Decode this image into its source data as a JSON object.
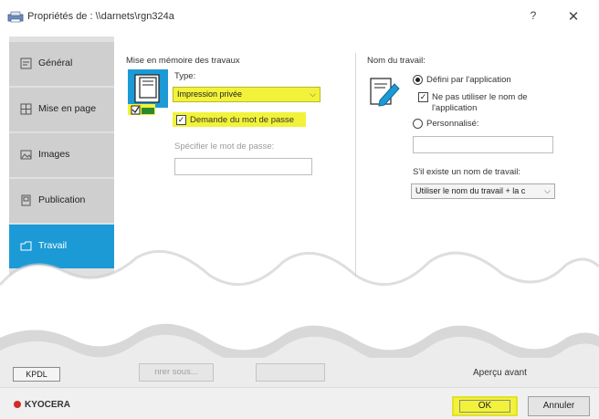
{
  "window": {
    "title": "Propriétés de : \\\\darnets\\rgn324a",
    "help_label": "?",
    "close_label": "✕"
  },
  "sidebar": {
    "items": [
      {
        "label": "Général",
        "icon": "document-icon"
      },
      {
        "label": "Mise en page",
        "icon": "layout-grid-icon"
      },
      {
        "label": "Images",
        "icon": "image-icon"
      },
      {
        "label": "Publication",
        "icon": "booklet-icon"
      },
      {
        "label": "Travail",
        "icon": "job-folder-icon",
        "active": true
      }
    ]
  },
  "job_storage": {
    "section_title": "Mise en mémoire des travaux",
    "type_label": "Type:",
    "type_value": "Impression privée",
    "password_request_label": "Demande du mot de passe",
    "password_request_checked": true,
    "specify_password_label": "Spécifier le mot de passe:",
    "specify_password_value": ""
  },
  "job_name": {
    "section_title": "Nom du travail:",
    "defined_by_app_label": "Défini par l'application",
    "no_app_name_label_line1": "Ne pas utiliser le nom de",
    "no_app_name_label_line2": "l'application",
    "custom_label": "Personnalisé:",
    "custom_value": "",
    "if_exists_label": "S'il existe un nom de travail:",
    "if_exists_value": "Utiliser le nom du travail + la c"
  },
  "bottom": {
    "kpdl_label": "KPDL",
    "save_label": "nrer sous...",
    "preview_label": "Aperçu avant"
  },
  "footer": {
    "logo": "KYOCERA",
    "ok_label": "OK",
    "cancel_label": "Annuler"
  },
  "colors": {
    "accent": "#1c9ad6",
    "highlight": "#f2f23a"
  }
}
